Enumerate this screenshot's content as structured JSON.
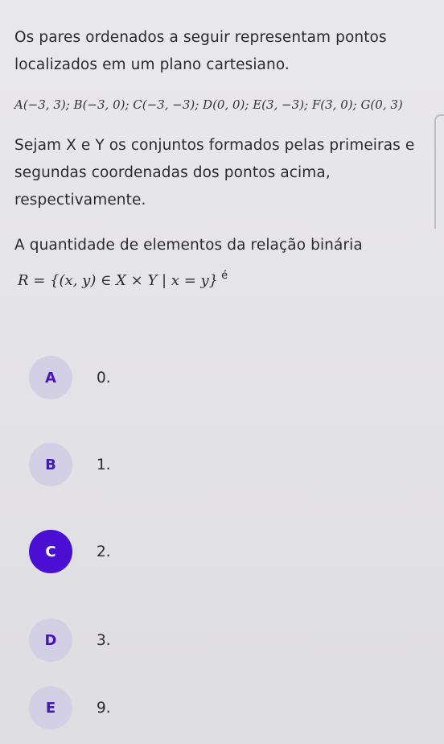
{
  "question": {
    "intro": "Os pares ordenados a seguir representam pontos localizados em um plano cartesiano.",
    "points": "A(−3, 3); B(−3, 0); C(−3, −3); D(0, 0); E(3, −3); F(3, 0); G(0, 3)",
    "sets_text": "Sejam X e Y os conjuntos formados pelas primeiras e segundas coordenadas dos pontos acima, respectivamente.",
    "prompt_text": "A quantidade de elementos da relação binária",
    "formula": "R = {(x, y) ∈ X × Y | x = y}",
    "formula_tail": "é"
  },
  "options": [
    {
      "letter": "A",
      "text": "0.",
      "selected": false
    },
    {
      "letter": "B",
      "text": "1.",
      "selected": false
    },
    {
      "letter": "C",
      "text": "2.",
      "selected": true
    },
    {
      "letter": "D",
      "text": "3.",
      "selected": false
    },
    {
      "letter": "E",
      "text": "9.",
      "selected": false
    }
  ],
  "colors": {
    "accent": "#4a0fd2",
    "option_circle": "#d3cfe4",
    "option_letter": "#4318b6",
    "text": "#2b2b2f",
    "background": "#e6e5e9"
  }
}
